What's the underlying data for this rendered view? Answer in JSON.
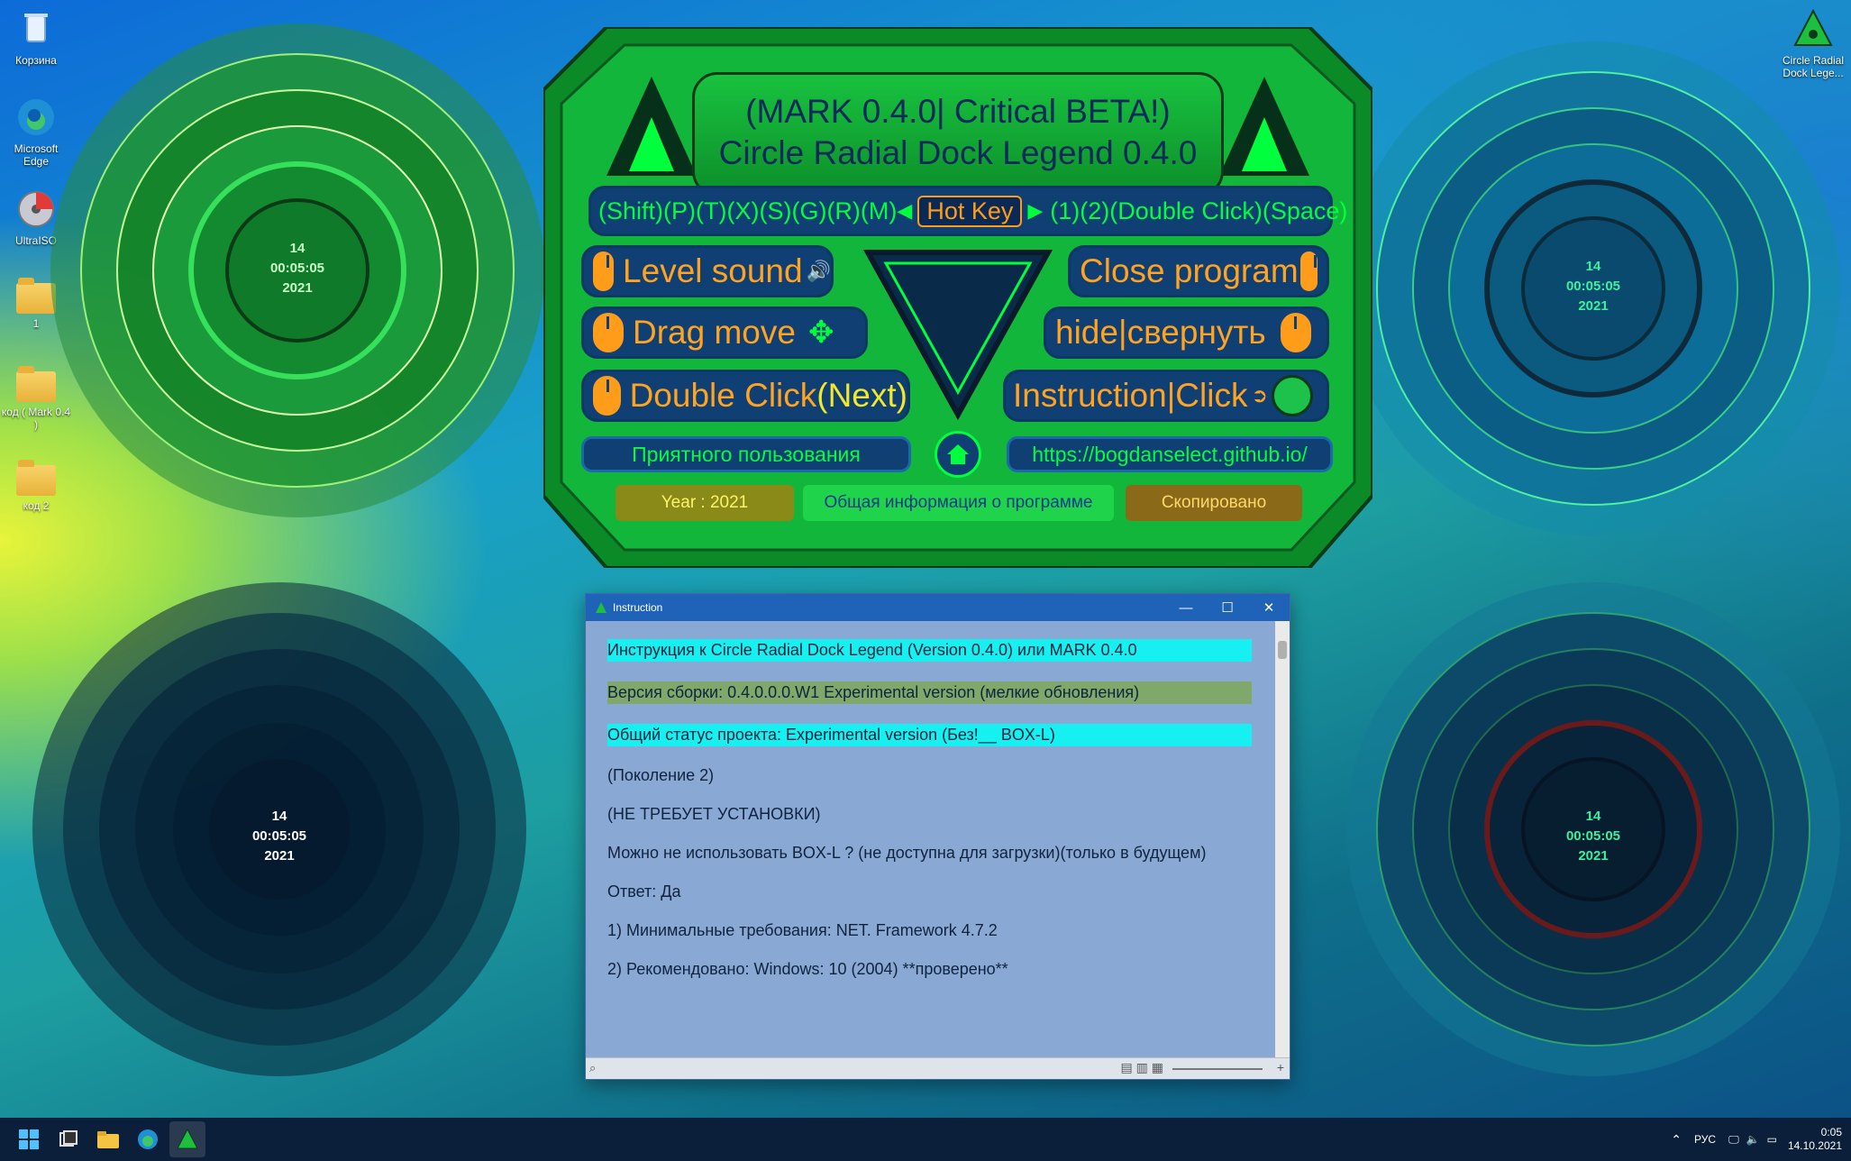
{
  "desktop": {
    "icons": [
      {
        "label": "Корзина"
      },
      {
        "label": "Microsoft Edge"
      },
      {
        "label": "UltraISO"
      },
      {
        "label": "1"
      },
      {
        "label": "код ( Mark 0.4 )"
      },
      {
        "label": "код 2"
      }
    ],
    "right_icon": {
      "label": "Circle Radial Dock Lege..."
    }
  },
  "docks": [
    {
      "clock_day": "14",
      "clock_time": "00:05:05",
      "clock_year": "2021",
      "theme": "green"
    },
    {
      "clock_day": "14",
      "clock_time": "00:05:05",
      "clock_year": "2021",
      "theme": "teal"
    },
    {
      "clock_day": "14",
      "clock_time": "00:05:05",
      "clock_year": "2021",
      "theme": "dark"
    },
    {
      "clock_day": "14",
      "clock_time": "00:05:05",
      "clock_year": "2021",
      "theme": "navy"
    }
  ],
  "panel": {
    "title_line1": "(MARK 0.4.0|  Critical BETA!)",
    "title_line2": "Circle Radial Dock Legend 0.4.0",
    "hotkeys_left": "(Shift)(P)(T)(X)(S)(G)(R)(M)",
    "hotkey_label": "Hot Key",
    "hotkeys_right": "(1)(2)(Double Click)(Space)",
    "level_sound": "Level sound",
    "close_program": "Close program",
    "drag_move": "Drag move",
    "hide": "hide|свернуть",
    "double_click": "Double Click",
    "double_click_next": "(Next)",
    "instruction": "Instruction|Click",
    "greeting": "Приятного пользования",
    "url": "https://bogdanselect.github.io/",
    "year": "Year : 2021",
    "info": "Общая информация о программе",
    "copied": "Скопировано"
  },
  "window": {
    "title": "Instruction",
    "lines": [
      "Инструкция к Circle Radial Dock Legend (Version 0.4.0) или MARK 0.4.0",
      "Версия сборки: 0.4.0.0.0.W1 Experimental version (мелкие обновления)",
      "Общий статус проекта: Experimental version (Без!__ BOX-L)",
      "(Поколение 2)",
      "(НЕ ТРЕБУЕТ УСТАНОВКИ)",
      "Можно не использовать BOX-L ? (не доступна для загрузки)(только в будущем)",
      "Ответ: Да",
      "1) Минимальные требования: NET. Framework 4.7.2",
      "2) Рекомендовано: Windows: 10 (2004) **проверено**"
    ],
    "highlight_colors": [
      "#16f0f0",
      "#7fa86a",
      "#16f0f0"
    ]
  },
  "taskbar": {
    "lang": "РУС",
    "time": "0:05",
    "date": "14.10.2021"
  },
  "colors": {
    "accent_green": "#00ff3c",
    "accent_orange": "#ffa321",
    "panel_green": "#18c23f",
    "panel_blue": "#0f3f73"
  }
}
